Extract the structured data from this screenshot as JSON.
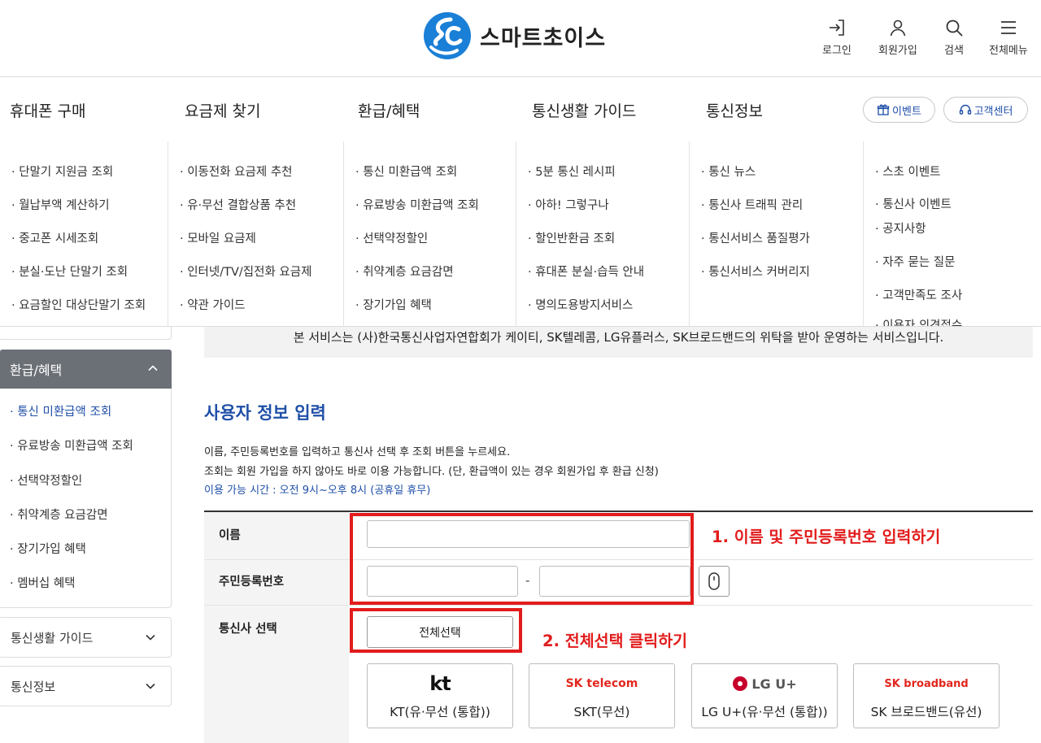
{
  "header": {
    "logo_text": "스마트초이스",
    "utils": [
      {
        "label": "로그인",
        "icon": "login-icon"
      },
      {
        "label": "회원가입",
        "icon": "user-icon"
      },
      {
        "label": "검색",
        "icon": "search-icon"
      },
      {
        "label": "전체메뉴",
        "icon": "menu-icon"
      }
    ]
  },
  "gnb": {
    "items": [
      "휴대폰 구매",
      "요금제 찾기",
      "환급/혜택",
      "통신생활 가이드",
      "통신정보"
    ],
    "event_label": "이벤트",
    "support_label": "고객센터"
  },
  "mega_menu": {
    "columns": [
      [
        "· 단말기 지원금 조회",
        "· 월납부액 계산하기",
        "· 중고폰 시세조회",
        "· 분실·도난 단말기 조회",
        "· 요금할인 대상단말기 조회"
      ],
      [
        "· 이동전화 요금제 추천",
        "· 유·무선 결합상품 추천",
        "· 모바일 요금제",
        "· 인터넷/TV/집전화 요금제",
        "· 약관 가이드"
      ],
      [
        "· 통신 미환급액 조회",
        "· 유료방송 미환급액 조회",
        "· 선택약정할인",
        "· 취약계층 요금감면",
        "· 장기가입 혜택"
      ],
      [
        "· 5분 통신 레시피",
        "· 아하! 그렇구나",
        "· 할인반환금 조회",
        "· 휴대폰 분실·습득 안내",
        "· 명의도용방지서비스"
      ],
      [
        "· 통신 뉴스",
        "· 통신사 트래픽 관리",
        "· 통신서비스 품질평가",
        "· 통신서비스 커버리지"
      ],
      [
        "· 스초 이벤트",
        "· 통신사 이벤트",
        "· 공지사항",
        "· 자주 묻는 질문",
        "· 고객만족도 조사",
        "· 이용자 의견접수"
      ]
    ]
  },
  "sidebar": {
    "active_section": "환급/혜택",
    "items": [
      "· 통신 미환급액 조회",
      "· 유료방송 미환급액 조회",
      "· 선택약정할인",
      "· 취약계층 요금감면",
      "· 장기가입 혜택",
      "· 멤버십 혜택"
    ],
    "collapsed": [
      "통신생활 가이드",
      "통신정보"
    ]
  },
  "content": {
    "notice": "본 서비스는 (사)한국통신사업자연합회가 케이티, SK텔레콤, LG유플러스, SK브로드밴드의 위탁을 받아 운영하는 서비스입니다.",
    "title": "사용자 정보 입력",
    "desc1": "이름, 주민등록번호를 입력하고 통신사 선택 후 조회 버튼을 누르세요.",
    "desc2": "조회는 회원 가입을 하지 않아도 바로 이용 가능합니다. (단, 환급액이 있는 경우 회원가입 후 환급 신청)",
    "desc3": "이용 가능 시간 : 오전 9시~오후 8시 (공휴일 휴무)",
    "form": {
      "name_label": "이름",
      "name_value": "",
      "rrn_label": "주민등록번호",
      "rrn_front": "",
      "rrn_back": "",
      "rrn_sep": "-",
      "carrier_label": "통신사 선택",
      "select_all": "전체선택",
      "carriers": [
        {
          "logo": "kt",
          "name": "KT(유·무선 (통합))"
        },
        {
          "logo": "SK telecom",
          "name": "SKT(무선)"
        },
        {
          "logo": "LG U+",
          "name": "LG U+(유·무선 (통합))"
        },
        {
          "logo": "SK broadband",
          "name": "SK 브로드밴드(유선)"
        }
      ]
    }
  },
  "annotations": {
    "step1": "1. 이름 및 주민등록번호 입력하기",
    "step2": "2. 전체선택 클릭하기",
    "color": "#e21c1c"
  },
  "colors": {
    "brand_blue": "#1f4fa8",
    "logo_blue": "#1a7fd6",
    "sidebar_active": "#6b6f76"
  }
}
